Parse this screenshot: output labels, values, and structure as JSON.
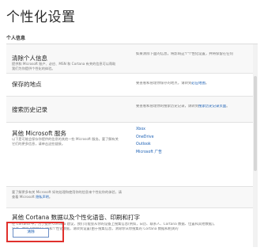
{
  "page": {
    "title": "个性化设置",
    "section_label": "个人信息"
  },
  "rows": {
    "clear_personal": {
      "title": "清除个人信息",
      "desc": "提供和 Microsoft 账户、必应、MSN 和 Cortana 有关的信息可以帮助我们为你提供个性化的体验。",
      "right": "如果清除下面的信息，将影响这个个性化设置，并将保留在任何"
    },
    "saved_places": {
      "title": "保存的地点",
      "right_prefix": "要查看和管理你保存的地点，请转到",
      "right_link": "必应地图",
      "right_suffix": "。"
    },
    "search_history": {
      "title": "搜索历史记录",
      "right_prefix": "要查看和管理你的搜索历史记录，请转到",
      "right_link": "搜索历史记录页面",
      "right_suffix": "。"
    },
    "other_services": {
      "title": "其他 Microsoft 服务",
      "desc": "以下是可能会保存你提供的信息的其他一些 Microsoft 服务。要了解有关它们的更多信息，请单击这些链接。",
      "links": [
        "Xbox",
        "OneDrive",
        "Outlook",
        "Microsoft 广告"
      ]
    },
    "privacy": {
      "desc_prefix": "要了解更多有关 Microsoft 如何处理和使用你的信息来个性化你的体验，请查看 Microsoft ",
      "desc_link": "隐私声明",
      "desc_suffix": "。"
    },
    "cortana": {
      "title": "其他 Cortana 数据以及个性化语音、印刷和打字",
      "desc": "在 Cortana 中，为了提供 Cortana 建议，我们可能会从你的设备上搜集信息(例如，日历、联系人、Cortana 数据、位置和其他数据)。",
      "desc2": "包括，合舍上传你的日历和个性化数据，请转到设置(由于搜集信息，清除你从你搜集的 Cortana 数据和相关的"
    }
  },
  "buttons": {
    "clear": "清除"
  }
}
